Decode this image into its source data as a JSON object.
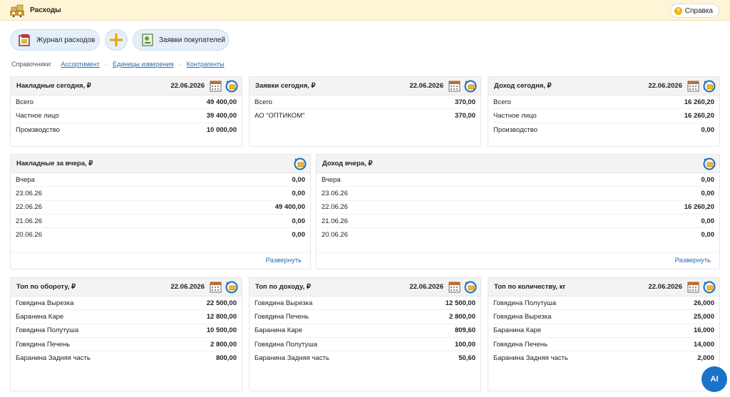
{
  "header": {
    "title": "Расходы",
    "help_label": "Справка"
  },
  "actions": {
    "journal_label": "Журнал расходов",
    "orders_label": "Заявки покупателей"
  },
  "refs": {
    "prefix": "Справочники:",
    "links": [
      "Ассортимент",
      "Единицы измерения",
      "Контрагенты"
    ]
  },
  "cards": {
    "invoices_today": {
      "title": "Накладные сегодня, ₽",
      "date": "22.06.2026",
      "rows": [
        [
          "Всего",
          "49 400,00"
        ],
        [
          "Частное лицо",
          "39 400,00"
        ],
        [
          "Производство",
          "10 000,00"
        ]
      ]
    },
    "orders_today": {
      "title": "Заявки сегодня, ₽",
      "date": "22.06.2026",
      "rows": [
        [
          "Всего",
          "370,00"
        ],
        [
          "АО \"ОПТИКОМ\"",
          "370,00"
        ]
      ]
    },
    "income_today": {
      "title": "Доход сегодня, ₽",
      "date": "22.06.2026",
      "rows": [
        [
          "Всего",
          "16 260,20"
        ],
        [
          "Частное лицо",
          "16 260,20"
        ],
        [
          "Производство",
          "0,00"
        ]
      ]
    },
    "invoices_yesterday": {
      "title": "Накладные за вчера, ₽",
      "expand": "Развернуть",
      "rows": [
        [
          "Вчера",
          "0,00"
        ],
        [
          "23.06.26",
          "0,00"
        ],
        [
          "22.06.26",
          "49 400,00"
        ],
        [
          "21.06.26",
          "0,00"
        ],
        [
          "20.06.26",
          "0,00"
        ]
      ]
    },
    "income_yesterday": {
      "title": "Доход вчера, ₽",
      "expand": "Развернуть",
      "rows": [
        [
          "Вчера",
          "0,00"
        ],
        [
          "23.06.26",
          "0,00"
        ],
        [
          "22.06.26",
          "16 260,20"
        ],
        [
          "21.06.26",
          "0,00"
        ],
        [
          "20.06.26",
          "0,00"
        ]
      ]
    },
    "top_turnover": {
      "title": "Топ по обороту, ₽",
      "date": "22.06.2026",
      "rows": [
        [
          "Говядина Вырезка",
          "22 500,00"
        ],
        [
          "Баранина Каре",
          "12 800,00"
        ],
        [
          "Говядина Полутуша",
          "10 500,00"
        ],
        [
          "Говядина Печень",
          "2 800,00"
        ],
        [
          "Баранина Задняя часть",
          "800,00"
        ]
      ]
    },
    "top_income": {
      "title": "Топ по доходу, ₽",
      "date": "22.06.2026",
      "rows": [
        [
          "Говядина Вырезка",
          "12 500,00"
        ],
        [
          "Говядина Печень",
          "2 800,00"
        ],
        [
          "Баранина Каре",
          "809,60"
        ],
        [
          "Говядина Полутуша",
          "100,00"
        ],
        [
          "Баранина Задняя часть",
          "50,60"
        ]
      ]
    },
    "top_quantity": {
      "title": "Топ по количеству, кг",
      "date": "22.06.2026",
      "rows": [
        [
          "Говядина Полутуша",
          "26,000"
        ],
        [
          "Говядина Вырезка",
          "25,000"
        ],
        [
          "Баранина Каре",
          "16,000"
        ],
        [
          "Говядина Печень",
          "14,000"
        ],
        [
          "Баранина Задняя часть",
          "2,000"
        ]
      ]
    }
  },
  "ai_label": "AI"
}
